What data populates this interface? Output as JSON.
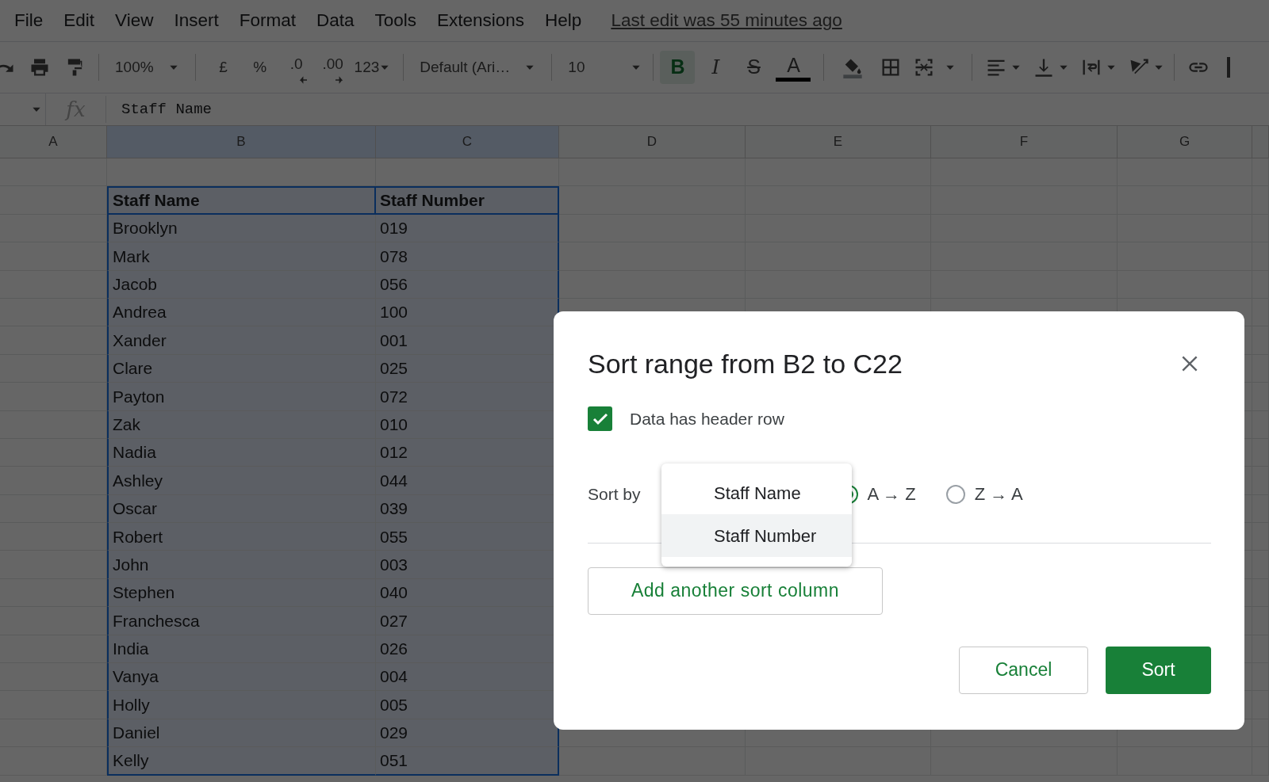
{
  "menu_bar": {
    "items": [
      "File",
      "Edit",
      "View",
      "Insert",
      "Format",
      "Data",
      "Tools",
      "Extensions",
      "Help"
    ],
    "last_edit": "Last edit was 55 minutes ago"
  },
  "toolbar": {
    "zoom": "100%",
    "currency": "£",
    "percent": "%",
    "decrease_decimals": ".0",
    "increase_decimals": ".00",
    "number_format": "123",
    "font": "Default (Ari…",
    "font_size": "10",
    "bold": {
      "label": "B",
      "on": true
    },
    "italic": {
      "label": "I",
      "on": false
    },
    "strikethrough": {
      "label": "S",
      "on": false
    },
    "text_color": {
      "label": "A"
    }
  },
  "formula_bar": {
    "fx": "fx",
    "value": "Staff Name"
  },
  "sheet": {
    "columns": [
      {
        "label": "A",
        "selected": false
      },
      {
        "label": "B",
        "selected": true
      },
      {
        "label": "C",
        "selected": true
      },
      {
        "label": "D",
        "selected": false
      },
      {
        "label": "E",
        "selected": false
      },
      {
        "label": "F",
        "selected": false
      },
      {
        "label": "G",
        "selected": false
      }
    ],
    "rows": [
      {
        "kind": "header",
        "selected": true,
        "cells": [
          "Staff Name",
          "Staff Number"
        ]
      },
      {
        "kind": "data",
        "selected": true,
        "cells": [
          "Brooklyn",
          "019"
        ]
      },
      {
        "kind": "data",
        "selected": true,
        "cells": [
          "Mark",
          "078"
        ]
      },
      {
        "kind": "data",
        "selected": true,
        "cells": [
          "Jacob",
          "056"
        ]
      },
      {
        "kind": "data",
        "selected": true,
        "cells": [
          "Andrea",
          "100"
        ]
      },
      {
        "kind": "data",
        "selected": true,
        "cells": [
          "Xander",
          "001"
        ]
      },
      {
        "kind": "data",
        "selected": true,
        "cells": [
          "Clare",
          "025"
        ]
      },
      {
        "kind": "data",
        "selected": true,
        "cells": [
          "Payton",
          "072"
        ]
      },
      {
        "kind": "data",
        "selected": true,
        "cells": [
          "Zak",
          "010"
        ]
      },
      {
        "kind": "data",
        "selected": true,
        "cells": [
          "Nadia",
          "012"
        ]
      },
      {
        "kind": "data",
        "selected": true,
        "cells": [
          "Ashley",
          "044"
        ]
      },
      {
        "kind": "data",
        "selected": true,
        "cells": [
          "Oscar",
          "039"
        ]
      },
      {
        "kind": "data",
        "selected": true,
        "cells": [
          "Robert",
          "055"
        ]
      },
      {
        "kind": "data",
        "selected": true,
        "cells": [
          "John",
          "003"
        ]
      },
      {
        "kind": "data",
        "selected": true,
        "cells": [
          "Stephen",
          "040"
        ]
      },
      {
        "kind": "data",
        "selected": true,
        "cells": [
          "Franchesca",
          "027"
        ]
      },
      {
        "kind": "data",
        "selected": true,
        "cells": [
          "India",
          "026"
        ]
      },
      {
        "kind": "data",
        "selected": true,
        "cells": [
          "Vanya",
          "004"
        ]
      },
      {
        "kind": "data",
        "selected": true,
        "cells": [
          "Holly",
          "005"
        ]
      },
      {
        "kind": "data",
        "selected": true,
        "cells": [
          "Daniel",
          "029"
        ]
      },
      {
        "kind": "data",
        "selected": true,
        "cells": [
          "Kelly",
          "051"
        ]
      }
    ]
  },
  "dialog": {
    "title": "Sort range from B2 to C22",
    "header_checkbox": {
      "label": "Data has header row",
      "checked": true
    },
    "sort_by": {
      "label": "Sort by",
      "menu": [
        {
          "label": "Staff Name",
          "highlighted": false
        },
        {
          "label": "Staff Number",
          "highlighted": true
        }
      ]
    },
    "order": [
      {
        "label": "A → Z",
        "selected": true
      },
      {
        "label": "Z → A",
        "selected": false
      }
    ],
    "add_button": "Add another sort column",
    "buttons": [
      {
        "label": "Cancel",
        "kind": "secondary"
      },
      {
        "label": "Sort",
        "kind": "primary"
      }
    ]
  }
}
